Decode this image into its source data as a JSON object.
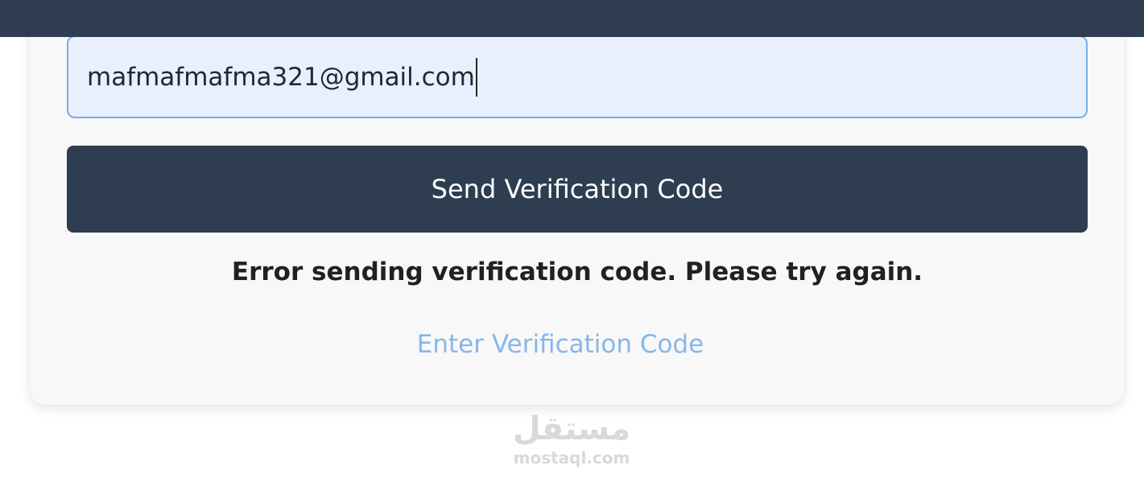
{
  "form": {
    "email_value": "mafmafmafma321@gmail.com",
    "send_button_label": "Send Verification Code",
    "error_message": "Error sending verification code. Please try again.",
    "enter_code_link": "Enter Verification Code"
  },
  "watermark": {
    "arabic": "مستقل",
    "latin": "mostaql.com"
  },
  "colors": {
    "header": "#2e3d50",
    "button": "#2e3d50",
    "input_background": "#e8f0fe",
    "input_border": "#7aaee8",
    "link": "#86b7e8",
    "card": "#f8f8f8"
  }
}
